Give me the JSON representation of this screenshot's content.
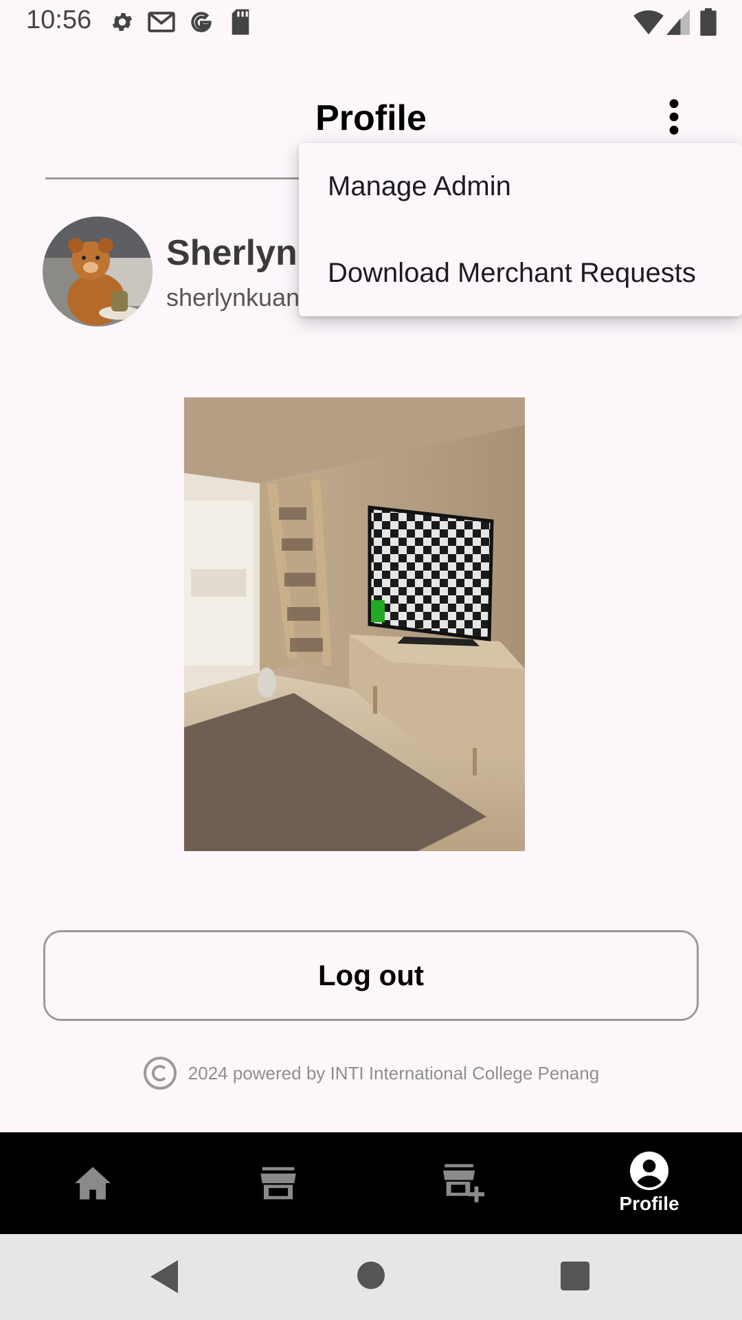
{
  "status_bar": {
    "time": "10:56",
    "icons": [
      "settings-icon",
      "gmail-icon",
      "google-icon",
      "sd-card-icon",
      "wifi-icon",
      "cell-signal-icon",
      "battery-icon"
    ]
  },
  "app_bar": {
    "title": "Profile",
    "more_icon": "more-vert-icon"
  },
  "profile": {
    "name": "Sherlyn",
    "email": "sherlynkuan"
  },
  "menu": {
    "items": [
      {
        "label": "Manage Admin"
      },
      {
        "label": "Download Merchant Requests"
      }
    ]
  },
  "logout": {
    "label": "Log out"
  },
  "footer": {
    "text": "2024 powered by INTI International College Penang"
  },
  "bottom_nav": {
    "items": [
      {
        "icon": "home-icon",
        "label": ""
      },
      {
        "icon": "store-icon",
        "label": ""
      },
      {
        "icon": "add-business-icon",
        "label": ""
      },
      {
        "icon": "account-circle-icon",
        "label": "Profile",
        "active": true
      }
    ]
  },
  "system_nav": {
    "icons": [
      "back-icon",
      "home-circle-icon",
      "recents-icon"
    ]
  },
  "colors": {
    "background": "#fdf7fc",
    "nav_background": "#000000",
    "system_nav": "#e6e6e6"
  }
}
